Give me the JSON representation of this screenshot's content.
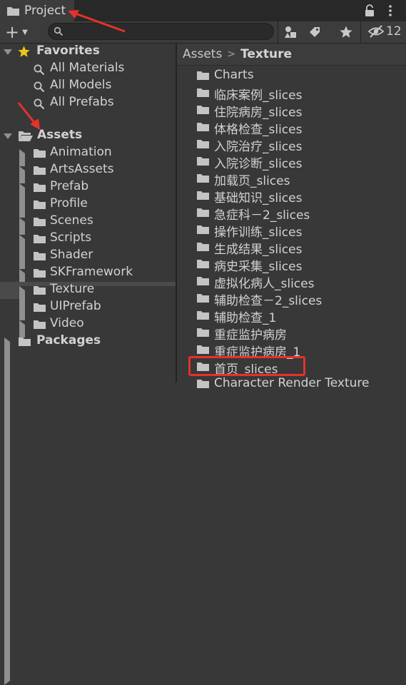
{
  "tab": {
    "title": "Project"
  },
  "toolbar": {
    "search_placeholder": "",
    "hidden_count": "12"
  },
  "tree": {
    "favorites": {
      "label": "Favorites",
      "items": [
        {
          "label": "All Materials"
        },
        {
          "label": "All Models"
        },
        {
          "label": "All Prefabs"
        }
      ]
    },
    "assets": {
      "label": "Assets",
      "items": [
        {
          "label": "Animation",
          "expandable": true
        },
        {
          "label": "ArtsAssets",
          "expandable": true
        },
        {
          "label": "Prefab",
          "expandable": true
        },
        {
          "label": "Profile",
          "expandable": false
        },
        {
          "label": "Scenes",
          "expandable": true
        },
        {
          "label": "Scripts",
          "expandable": true
        },
        {
          "label": "Shader",
          "expandable": false
        },
        {
          "label": "SKFramework",
          "expandable": true
        },
        {
          "label": "Texture",
          "expandable": true,
          "selected": true
        },
        {
          "label": "UIPrefab",
          "expandable": false
        },
        {
          "label": "Video",
          "expandable": true
        }
      ]
    },
    "packages": {
      "label": "Packages"
    }
  },
  "breadcrumb": {
    "root": "Assets",
    "current": "Texture"
  },
  "folder_contents": [
    "Charts",
    "临床案例_slices",
    "住院病房_slices",
    "体格检查_slices",
    "入院治疗_slices",
    "入院诊断_slices",
    "加载页_slices",
    "基础知识_slices",
    "急症科－2_slices",
    "操作训练_slices",
    "生成结果_slices",
    "病史采集_slices",
    "虚拟化病人_slices",
    "辅助检查－2_slices",
    "辅助检查_1",
    "重症监护病房",
    "重症监护病房_1",
    "首页_slices",
    "Character Render Texture"
  ],
  "colors": {
    "highlight": "#e5322b",
    "favorites_star": "#f0c419",
    "selected_row": "#4a4a4a"
  }
}
